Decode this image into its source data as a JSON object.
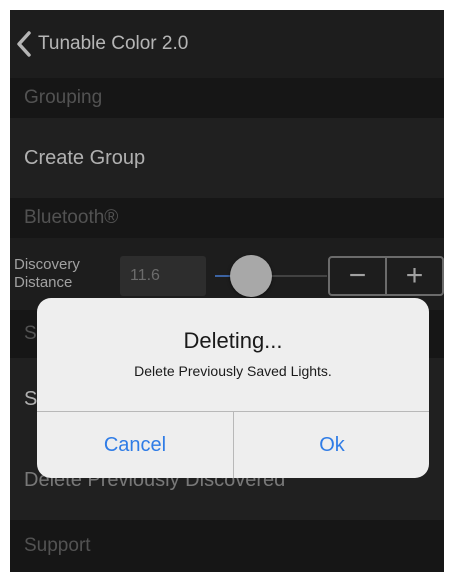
{
  "navbar": {
    "back_icon": "chevron-left-icon",
    "title": "Tunable Color 2.0"
  },
  "sections": {
    "grouping": "Grouping",
    "bluetooth": "Bluetooth®",
    "hidden_section_letter": "S",
    "support": "Support"
  },
  "rows": {
    "create_group": "Create Group",
    "hidden_row_letter": "S",
    "delete_previously_discovered": "Delete Previously Discovered"
  },
  "discovery": {
    "label": "Discovery Distance",
    "value": "11.6",
    "slider_level": 0.35,
    "minus_label": "−",
    "plus_label": "+"
  },
  "alert": {
    "title": "Deleting...",
    "message": "Delete Previously Saved Lights.",
    "cancel_label": "Cancel",
    "ok_label": "Ok"
  },
  "colors": {
    "accent": "#2f7ce6",
    "slider_fill": "#4d7fd0",
    "background": "#1f1f1f"
  }
}
